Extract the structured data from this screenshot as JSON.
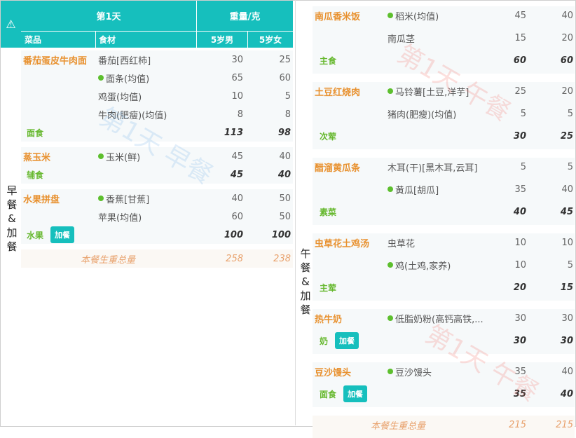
{
  "warning_icon": "⚠",
  "header": {
    "day": "第1天",
    "weight": "重量/克",
    "col_dish": "菜品",
    "col_ingredient": "食材",
    "col_boy": "5岁男",
    "col_girl": "5岁女"
  },
  "breakfast": {
    "meal_label": "早餐&加餐",
    "watermark": "第1天 早餐",
    "groups": [
      {
        "dish": "番茄蛋皮牛肉面",
        "items": [
          {
            "name": "番茄[西红柿]",
            "dot": false,
            "boy": "30",
            "girl": "25"
          },
          {
            "name": "面条(均值)",
            "dot": true,
            "boy": "65",
            "girl": "60"
          },
          {
            "name": "鸡蛋(均值)",
            "dot": false,
            "boy": "10",
            "girl": "5"
          },
          {
            "name": "牛肉(肥瘦)(均值)",
            "dot": false,
            "boy": "8",
            "girl": "8"
          }
        ],
        "category": "面食",
        "badge": "",
        "total_boy": "113",
        "total_girl": "98"
      },
      {
        "dish": "蒸玉米",
        "items": [
          {
            "name": "玉米(鲜)",
            "dot": true,
            "boy": "45",
            "girl": "40"
          }
        ],
        "category": "辅食",
        "badge": "",
        "total_boy": "45",
        "total_girl": "40"
      },
      {
        "dish": "水果拼盘",
        "items": [
          {
            "name": "香蕉[甘蕉]",
            "dot": true,
            "boy": "40",
            "girl": "50"
          },
          {
            "name": "苹果(均值)",
            "dot": false,
            "boy": "60",
            "girl": "50"
          }
        ],
        "category": "水果",
        "badge": "加餐",
        "total_boy": "100",
        "total_girl": "100"
      }
    ],
    "sum_label": "本餐生重总量",
    "sum_boy": "258",
    "sum_girl": "238"
  },
  "lunch": {
    "meal_label": "午餐&加餐",
    "watermark": "第1天 午餐",
    "groups": [
      {
        "dish": "南瓜香米饭",
        "items": [
          {
            "name": "稻米(均值)",
            "dot": true,
            "boy": "45",
            "girl": "40"
          },
          {
            "name": "南瓜茎",
            "dot": false,
            "boy": "15",
            "girl": "20"
          }
        ],
        "category": "主食",
        "badge": "",
        "total_boy": "60",
        "total_girl": "60"
      },
      {
        "dish": "土豆红烧肉",
        "items": [
          {
            "name": "马铃薯[土豆,洋芋]",
            "dot": true,
            "boy": "25",
            "girl": "20"
          },
          {
            "name": "猪肉(肥瘦)(均值)",
            "dot": false,
            "boy": "5",
            "girl": "5"
          }
        ],
        "category": "次荤",
        "badge": "",
        "total_boy": "30",
        "total_girl": "25"
      },
      {
        "dish": "醋溜黄瓜条",
        "items": [
          {
            "name": "木耳(干)[黑木耳,云耳]",
            "dot": false,
            "boy": "5",
            "girl": "5"
          },
          {
            "name": "黄瓜[胡瓜]",
            "dot": true,
            "boy": "35",
            "girl": "40"
          }
        ],
        "category": "素菜",
        "badge": "",
        "total_boy": "40",
        "total_girl": "45"
      },
      {
        "dish": "虫草花土鸡汤",
        "items": [
          {
            "name": "虫草花",
            "dot": false,
            "boy": "10",
            "girl": "10"
          },
          {
            "name": "鸡(土鸡,家养)",
            "dot": true,
            "boy": "10",
            "girl": "5"
          }
        ],
        "category": "主荤",
        "badge": "",
        "total_boy": "20",
        "total_girl": "15"
      },
      {
        "dish": "热牛奶",
        "items": [
          {
            "name": "低脂奶粉(高钙高铁,...",
            "dot": true,
            "boy": "30",
            "girl": "30"
          }
        ],
        "category": "奶",
        "badge": "加餐",
        "total_boy": "30",
        "total_girl": "30"
      },
      {
        "dish": "豆沙馒头",
        "items": [
          {
            "name": "豆沙馒头",
            "dot": true,
            "boy": "35",
            "girl": "40"
          }
        ],
        "category": "面食",
        "badge": "加餐",
        "total_boy": "35",
        "total_girl": "40"
      }
    ],
    "sum_label": "本餐生重总量",
    "sum_boy": "215",
    "sum_girl": "215"
  }
}
